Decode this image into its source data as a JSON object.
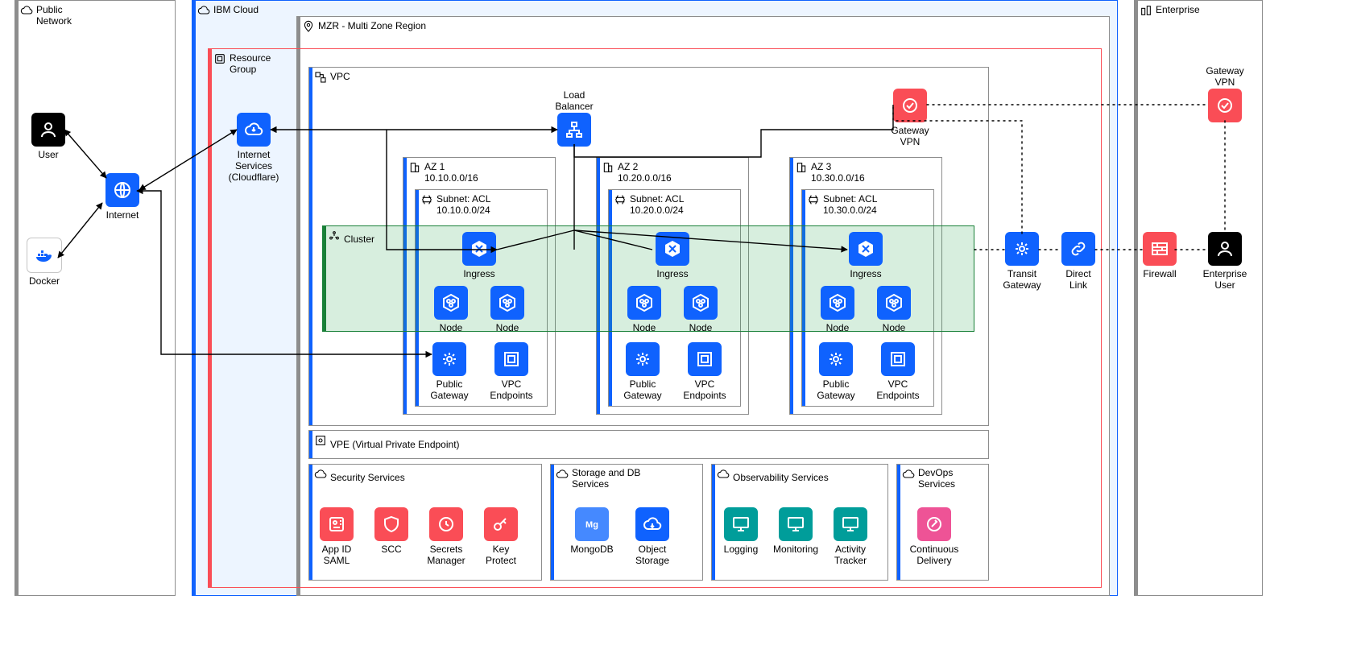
{
  "public_network": {
    "title": "Public\nNetwork",
    "user": "User",
    "internet": "Internet",
    "docker": "Docker"
  },
  "ibm_cloud": {
    "title": "IBM Cloud",
    "mzr": "MZR - Multi Zone Region",
    "resource_group": "Resource\nGroup",
    "internet_services": "Internet\nServices\n(Cloudflare)",
    "vpc": {
      "title": "VPC",
      "load_balancer": "Load\nBalancer",
      "gateway_vpn": "Gateway\nVPN",
      "az": [
        {
          "name": "AZ 1",
          "cidr": "10.10.0.0/16",
          "subnet": "Subnet: ACL",
          "subnet_cidr": "10.10.0.0/24"
        },
        {
          "name": "AZ 2",
          "cidr": "10.20.0.0/16",
          "subnet": "Subnet: ACL",
          "subnet_cidr": "10.20.0.0/24"
        },
        {
          "name": "AZ 3",
          "cidr": "10.30.0.0/16",
          "subnet": "Subnet: ACL",
          "subnet_cidr": "10.30.0.0/24"
        }
      ],
      "cluster": "Cluster",
      "ingress": "Ingress",
      "node": "Node",
      "public_gateway": "Public\nGateway",
      "vpc_endpoints": "VPC\nEndpoints"
    },
    "vpe": "VPE (Virtual Private Endpoint)",
    "security": {
      "title": "Security Services",
      "items": [
        "App ID\nSAML",
        "SCC",
        "Secrets\nManager",
        "Key\nProtect"
      ]
    },
    "storage": {
      "title": "Storage and DB\nServices",
      "items": [
        "MongoDB",
        "Object\nStorage"
      ]
    },
    "observability": {
      "title": "Observability Services",
      "items": [
        "Logging",
        "Monitoring",
        "Activity\nTracker"
      ]
    },
    "devops": {
      "title": "DevOps\nServices",
      "items": [
        "Continuous\nDelivery"
      ]
    },
    "transit_gateway": "Transit\nGateway",
    "direct_link": "Direct\nLink"
  },
  "enterprise": {
    "title": "Enterprise",
    "gateway_vpn": "Gateway\nVPN",
    "firewall": "Firewall",
    "user": "Enterprise\nUser"
  },
  "colors": {
    "blue": "#0f62fe",
    "lightblue": "#d0e2ff",
    "red": "#fa4d56",
    "black": "#000000",
    "teal": "#009d9a",
    "pink": "#ee5396",
    "mongo": "#4589ff",
    "green": "#198038",
    "greenfill": "#defbe6",
    "grey": "#8d8d8d"
  }
}
